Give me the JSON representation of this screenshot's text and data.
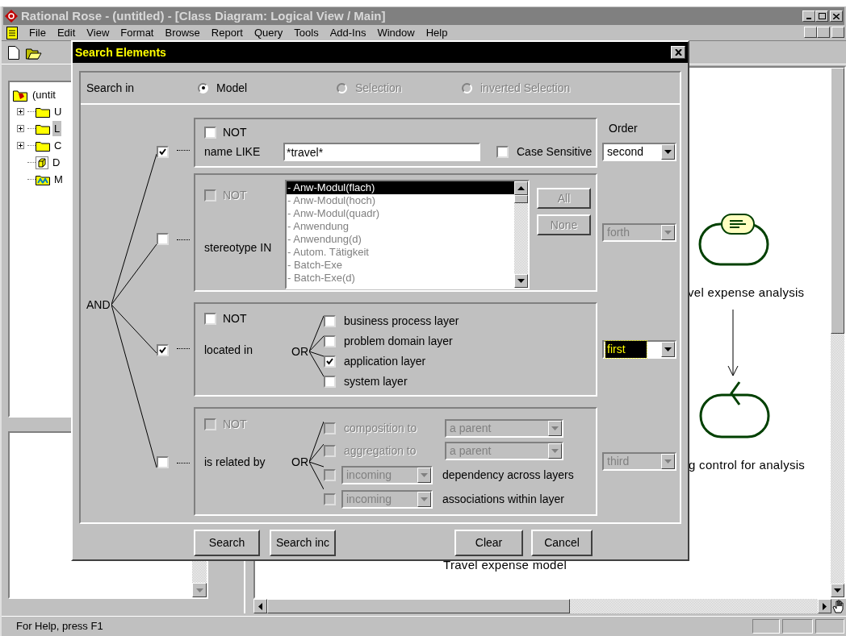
{
  "window": {
    "title": "Rational Rose - (untitled) - [Class Diagram: Logical View / Main]"
  },
  "menu": [
    {
      "label": "File"
    },
    {
      "label": "Edit"
    },
    {
      "label": "View"
    },
    {
      "label": "Format"
    },
    {
      "label": "Browse"
    },
    {
      "label": "Report"
    },
    {
      "label": "Query"
    },
    {
      "label": "Tools"
    },
    {
      "label": "Add-Ins"
    },
    {
      "label": "Window"
    },
    {
      "label": "Help"
    }
  ],
  "tree": {
    "label": "(untit",
    "children": [
      {
        "kind": "folder",
        "label": "U",
        "selected": false
      },
      {
        "kind": "folder",
        "label": "L",
        "selected": true
      },
      {
        "kind": "folder",
        "label": "C",
        "selected": false
      },
      {
        "kind": "deployment",
        "label": "D",
        "selected": false
      },
      {
        "kind": "properties",
        "label": "M",
        "selected": false
      }
    ]
  },
  "diagram": {
    "nodes": [
      {
        "kind": "boundary",
        "label": "vel expense analysis"
      },
      {
        "kind": "control",
        "label": "g control for analysis"
      }
    ],
    "package_label": "Travel expense model"
  },
  "dialog": {
    "title": "Search Elements",
    "search_in": {
      "label": "Search in",
      "options": [
        {
          "label": "Model",
          "selected": true,
          "disabled": false
        },
        {
          "label": "Selection",
          "selected": false,
          "disabled": true
        },
        {
          "label": "inverted Selection",
          "selected": false,
          "disabled": true
        }
      ]
    },
    "connector": "AND",
    "order_label": "Order",
    "criteria": [
      {
        "kind": "name",
        "checked": true,
        "not": {
          "label": "NOT",
          "checked": false,
          "disabled": false
        },
        "label": "name LIKE",
        "value": "*travel*",
        "case_sensitive": {
          "label": "Case Sensitive",
          "checked": false
        },
        "order": {
          "value": "second",
          "disabled": false,
          "focused": false
        }
      },
      {
        "kind": "stereotype",
        "checked": false,
        "not": {
          "label": "NOT",
          "checked": false,
          "disabled": true
        },
        "label": "stereotype IN",
        "disabled": true,
        "items": [
          {
            "label": "- Anw-Modul(flach)",
            "selected": true
          },
          {
            "label": "- Anw-Modul(hoch)",
            "selected": false
          },
          {
            "label": "- Anw-Modul(quadr)",
            "selected": false
          },
          {
            "label": "- Anwendung",
            "selected": false
          },
          {
            "label": "- Anwendung(d)",
            "selected": false
          },
          {
            "label": "- Autom. Tätigkeit",
            "selected": false
          },
          {
            "label": "- Batch-Exe",
            "selected": false
          },
          {
            "label": "- Batch-Exe(d)",
            "selected": false
          }
        ],
        "list_buttons": [
          {
            "label": "All",
            "disabled": true
          },
          {
            "label": "None",
            "disabled": true
          }
        ],
        "order": {
          "value": "forth",
          "disabled": true,
          "focused": false
        }
      },
      {
        "kind": "location",
        "checked": true,
        "not": {
          "label": "NOT",
          "checked": false,
          "disabled": false
        },
        "label": "located in",
        "connector": "OR",
        "options": [
          {
            "label": "business process layer",
            "checked": false
          },
          {
            "label": "problem domain layer",
            "checked": false
          },
          {
            "label": "application layer",
            "checked": true
          },
          {
            "label": "system layer",
            "checked": false
          }
        ],
        "order": {
          "value": "first",
          "disabled": false,
          "focused": true
        }
      },
      {
        "kind": "relation",
        "checked": false,
        "not": {
          "label": "NOT",
          "checked": false,
          "disabled": true
        },
        "label": "is related by",
        "connector": "OR",
        "disabled": true,
        "relations": [
          {
            "kind": "target",
            "label": "composition to",
            "value": "a parent",
            "checked": false
          },
          {
            "kind": "target",
            "label": "aggregation to",
            "value": "a parent",
            "checked": false
          },
          {
            "kind": "direction",
            "direction": "incoming",
            "label": "dependency across layers",
            "checked": false
          },
          {
            "kind": "direction",
            "direction": "incoming",
            "label": "associations within layer",
            "checked": false
          }
        ],
        "order": {
          "value": "third",
          "disabled": true,
          "focused": false
        }
      }
    ],
    "button_groups": [
      {
        "buttons": [
          {
            "label": "Search"
          },
          {
            "label": "Search inc"
          }
        ]
      },
      {
        "buttons": [
          {
            "label": "Clear"
          },
          {
            "label": "Cancel"
          }
        ]
      }
    ]
  },
  "status_bar": {
    "text": "For Help, press F1"
  }
}
